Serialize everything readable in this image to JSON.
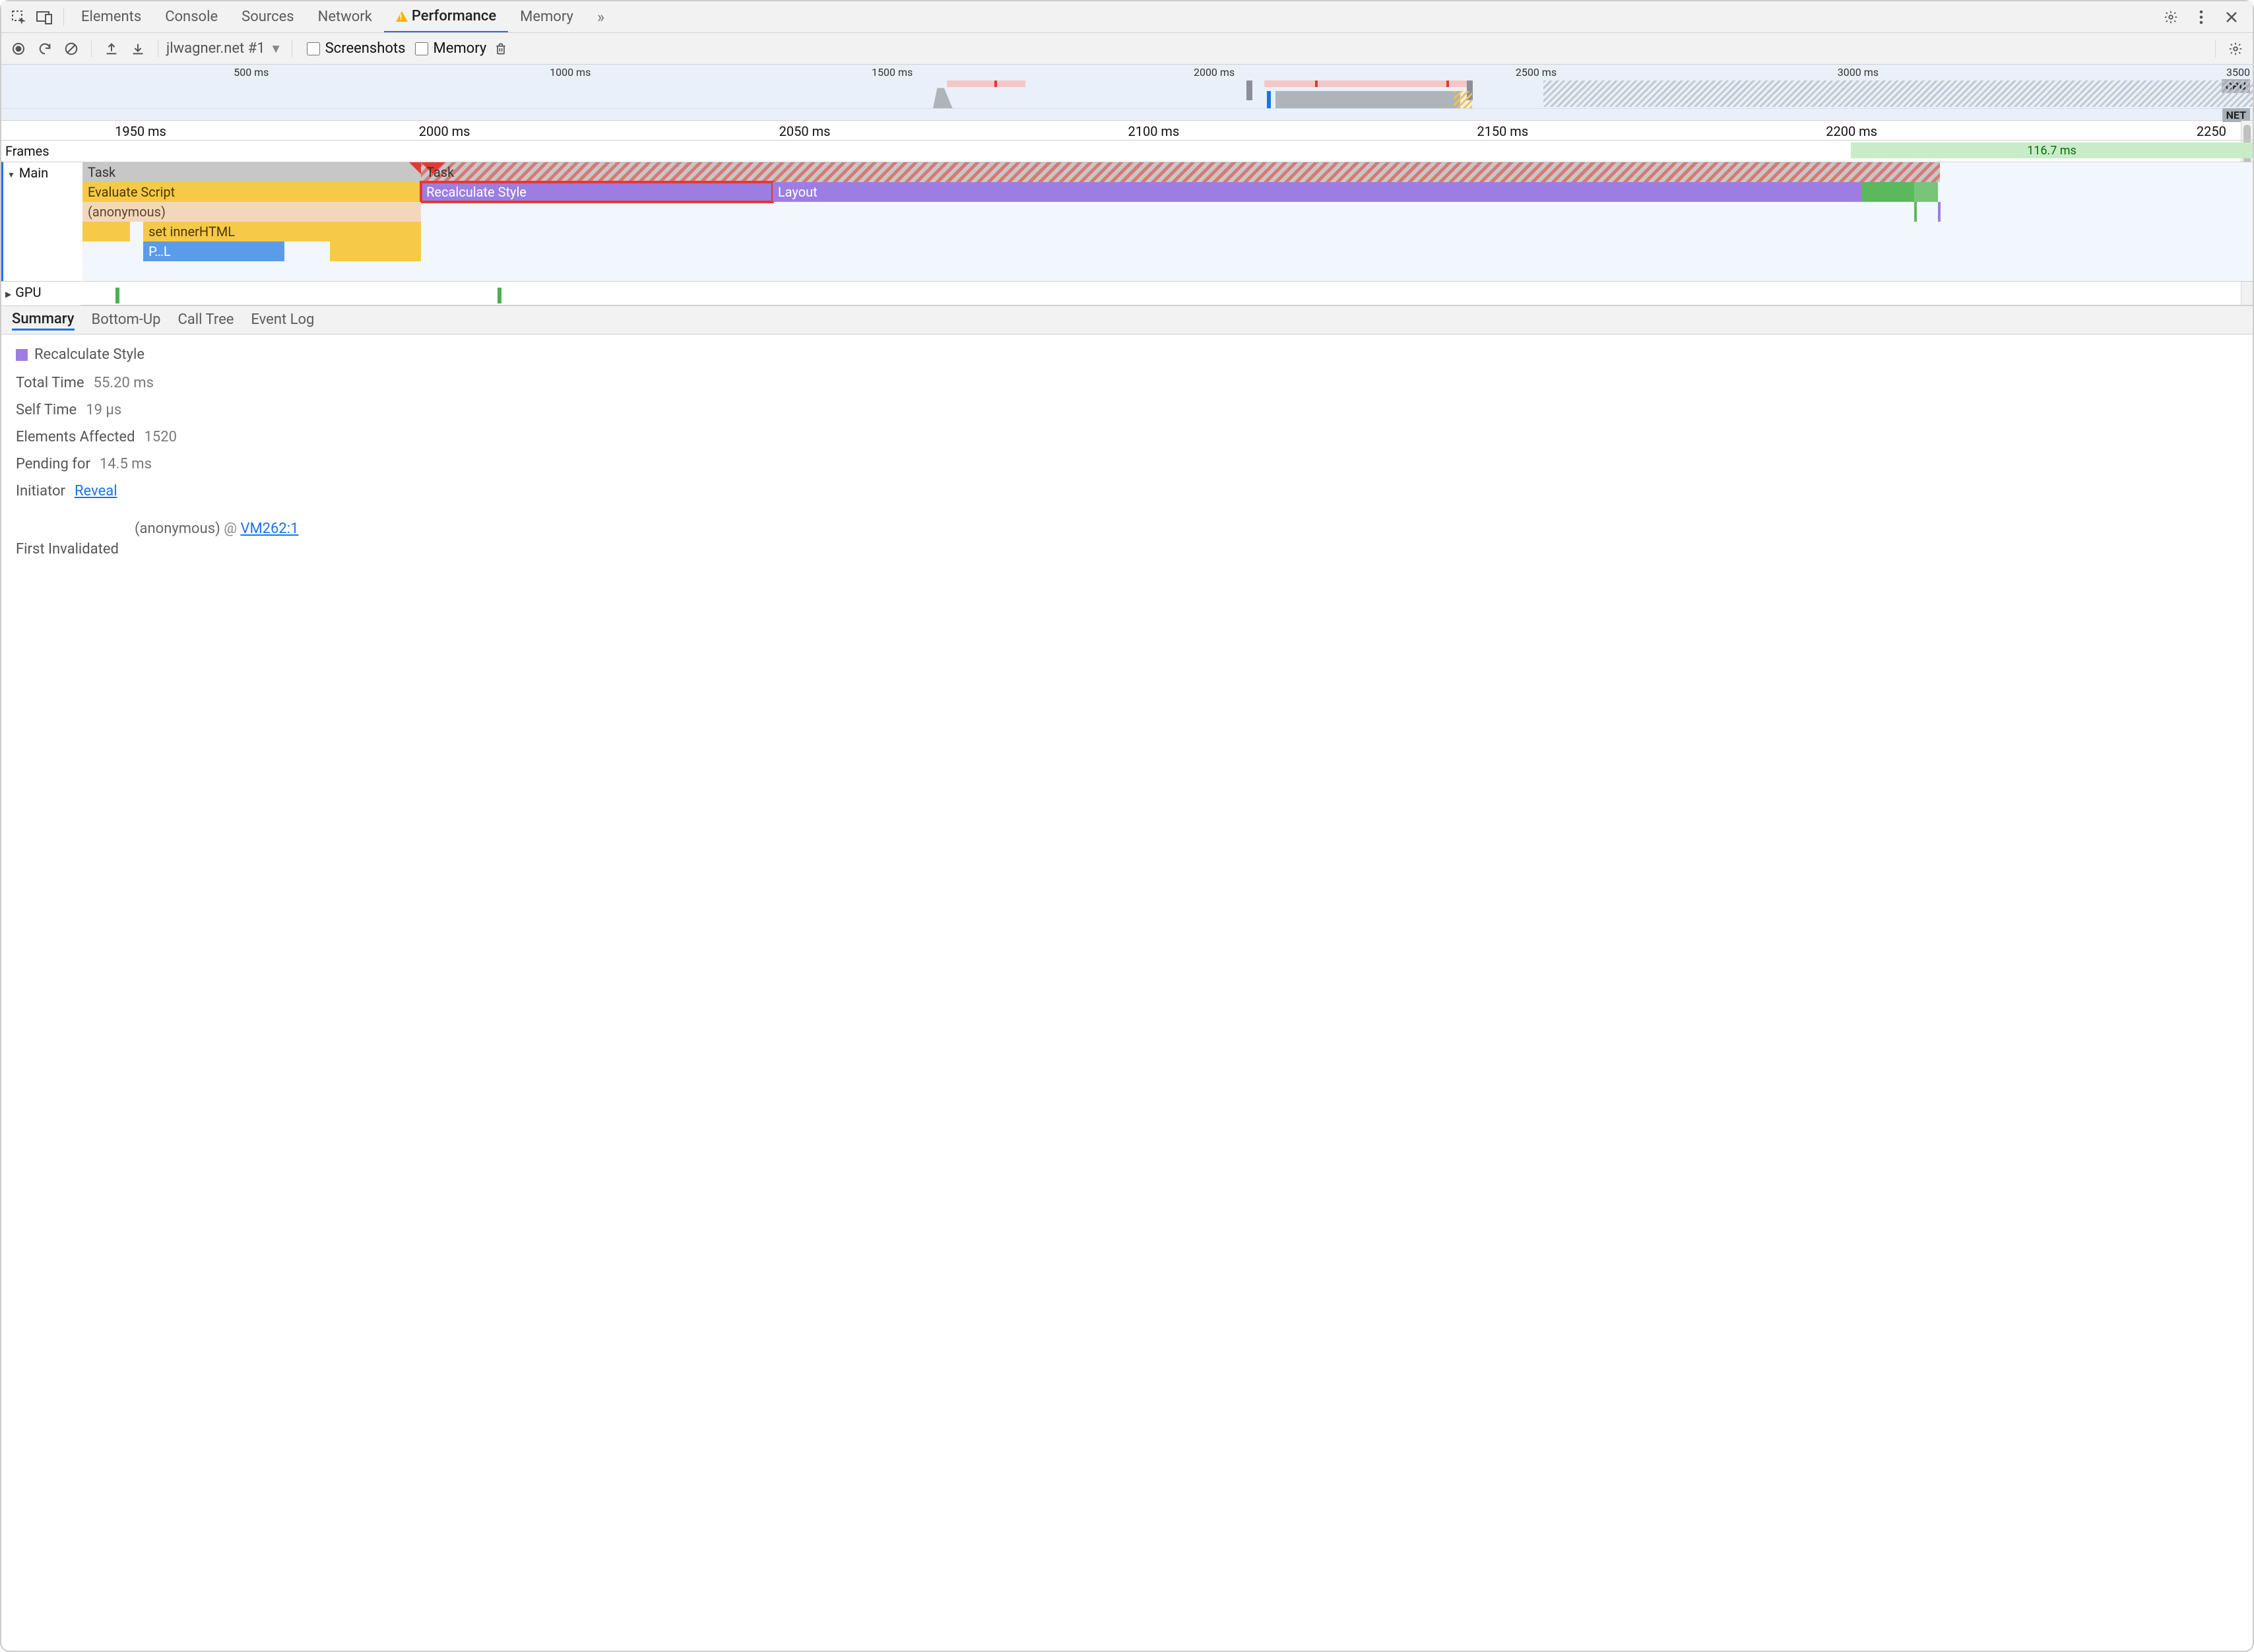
{
  "tabs": {
    "elements": "Elements",
    "console": "Console",
    "sources": "Sources",
    "network": "Network",
    "performance": "Performance",
    "memory": "Memory"
  },
  "perf": {
    "session": "jlwagner.net #1",
    "screenshots_label": "Screenshots",
    "memory_label": "Memory"
  },
  "overview": {
    "ticks_ms": [
      "500 ms",
      "1000 ms",
      "1500 ms",
      "2000 ms",
      "2500 ms",
      "3000 ms",
      "3500"
    ],
    "cpu_label": "CPU",
    "net_label": "NET"
  },
  "ruler": {
    "ticks": [
      "1950 ms",
      "2000 ms",
      "2050 ms",
      "2100 ms",
      "2150 ms",
      "2200 ms",
      "2250 ms"
    ]
  },
  "tracks": {
    "frames_label": "Frames",
    "frame_chip": "116.7 ms",
    "main_label": "Main",
    "gpu_label": "GPU",
    "blocks": {
      "task": "Task",
      "task2": "Task",
      "eval": "Evaluate Script",
      "recalc": "Recalculate Style",
      "layout": "Layout",
      "anon": "(anonymous)",
      "setinner": "set innerHTML",
      "pl": "P…L"
    }
  },
  "bottom_tabs": {
    "summary": "Summary",
    "bottomup": "Bottom-Up",
    "calltree": "Call Tree",
    "eventlog": "Event Log"
  },
  "details": {
    "title": "Recalculate Style",
    "total_time_k": "Total Time",
    "total_time_v": "55.20 ms",
    "self_time_k": "Self Time",
    "self_time_v": "19 µs",
    "elements_k": "Elements Affected",
    "elements_v": "1520",
    "pending_k": "Pending for",
    "pending_v": "14.5 ms",
    "initiator_k": "Initiator",
    "initiator_link": "Reveal",
    "first_inval_k": "First Invalidated",
    "src_fn": "(anonymous)",
    "src_at": "@",
    "src_loc": "VM262:1"
  }
}
